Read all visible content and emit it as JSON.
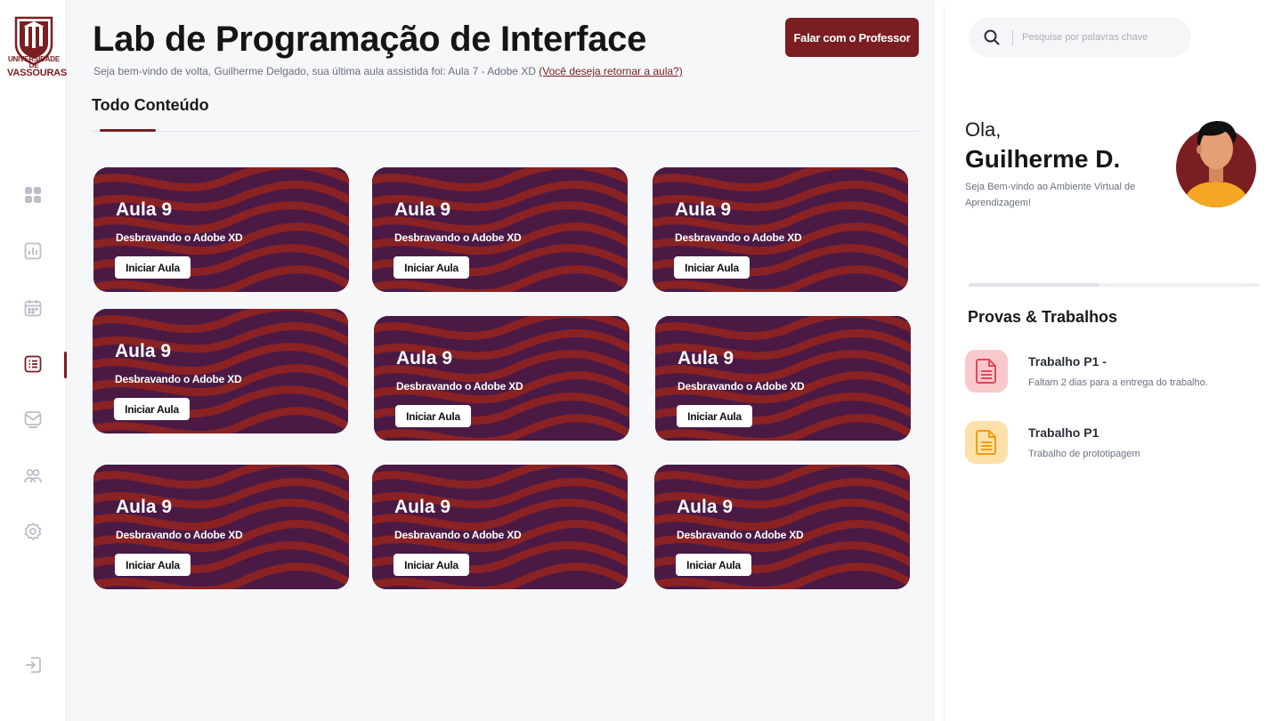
{
  "logo": {
    "line1": "UNIVERSIDADE DE",
    "line2": "VASSOURAS"
  },
  "sidebar": {
    "items": [
      {
        "icon": "dashboard-icon"
      },
      {
        "icon": "chart-icon"
      },
      {
        "icon": "calendar-icon"
      },
      {
        "icon": "list-icon",
        "active": true
      },
      {
        "icon": "mail-icon"
      },
      {
        "icon": "users-icon"
      },
      {
        "icon": "settings-icon"
      }
    ],
    "logout_icon": "logout-icon"
  },
  "header": {
    "title": "Lab de Programação de Interface",
    "subtitle": "Seja bem-vindo de volta, Guilherme Delgado, sua última aula assistida foi: Aula 7 - Adobe XD",
    "subtitle_link": "(Você deseja retornar a aula?)",
    "teacher_button": "Falar com o Professor"
  },
  "content": {
    "tab": "Todo Conteúdo",
    "cards": [
      {
        "title": "Aula 9",
        "subtitle": "Desbravando o Adobe XD",
        "button": "Iniciar Aula"
      },
      {
        "title": "Aula 9",
        "subtitle": "Desbravando o Adobe XD",
        "button": "Iniciar Aula"
      },
      {
        "title": "Aula 9",
        "subtitle": "Desbravando o Adobe XD",
        "button": "Iniciar Aula"
      },
      {
        "title": "Aula 9",
        "subtitle": "Desbravando o Adobe XD",
        "button": "Iniciar Aula"
      },
      {
        "title": "Aula 9",
        "subtitle": "Desbravando o Adobe XD",
        "button": "Iniciar Aula"
      },
      {
        "title": "Aula 9",
        "subtitle": "Desbravando o Adobe XD",
        "button": "Iniciar Aula"
      },
      {
        "title": "Aula 9",
        "subtitle": "Desbravando o Adobe XD",
        "button": "Iniciar Aula"
      },
      {
        "title": "Aula 9",
        "subtitle": "Desbravando o Adobe XD",
        "button": "Iniciar Aula"
      },
      {
        "title": "Aula 9",
        "subtitle": "Desbravando o Adobe XD",
        "button": "Iniciar Aula"
      }
    ]
  },
  "right_panel": {
    "search_placeholder": "Pesquise por palavras chave",
    "greeting": "Ola,",
    "user_name": "Guilherme D.",
    "welcome": "Seja Bem-vindo ao Ambiente Virtual de Aprendizagem!",
    "progress_fraction": 0.45,
    "tasks_title": "Provas & Trabalhos",
    "tasks": [
      {
        "title": "Trabalho P1 -",
        "desc": "Faltam 2 dias para a entrega do trabalho.",
        "icon_color": "#f9c9cc",
        "icon_stroke": "#e0485a"
      },
      {
        "title": "Trabalho P1",
        "desc": "Trabalho de prototipagem",
        "icon_color": "#fde1a8",
        "icon_stroke": "#f39c12"
      }
    ]
  },
  "colors": {
    "accent": "#7a1e22",
    "card_purple": "#4a1a45",
    "card_red": "#8a2223"
  }
}
